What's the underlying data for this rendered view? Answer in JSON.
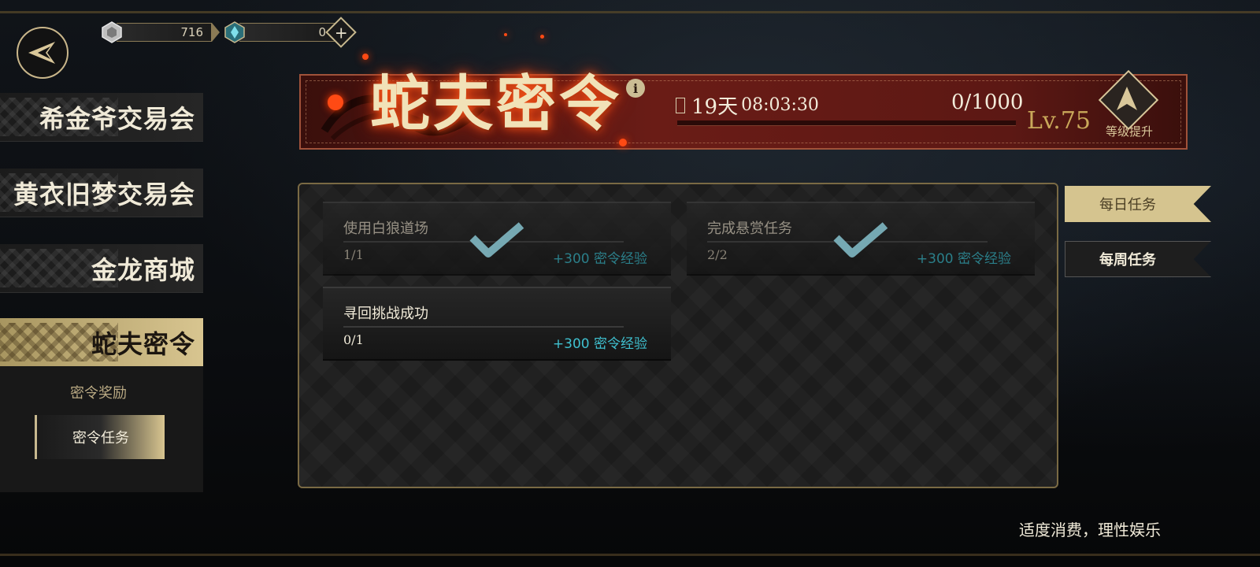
{
  "currency": {
    "silver": {
      "icon": "silver-coin-icon",
      "value": "716"
    },
    "gem": {
      "icon": "crystal-gem-icon",
      "value": "0"
    },
    "add_icon": "plus-icon"
  },
  "nav": {
    "back_icon": "back-arrow-icon",
    "menu": [
      {
        "label": "希金爷交易会"
      },
      {
        "label": "黄衣旧梦交易会"
      },
      {
        "label": "金龙商城"
      },
      {
        "label": "蛇夫密令"
      }
    ],
    "submenu": [
      {
        "label": "密令奖励"
      },
      {
        "label": "密令任务"
      }
    ]
  },
  "banner": {
    "title": "蛇夫密令",
    "info_icon": "i",
    "timer_days": "19天",
    "timer_clock": "08:03:30",
    "progress_text": "0/1000",
    "progress": {
      "current": 0,
      "max": 1000
    },
    "level": "Lv.75",
    "level_up_label": "等级提升"
  },
  "tasks": [
    {
      "name": "使用白狼道场",
      "count": "1/1",
      "reward": "+300 密令经验",
      "completed": true
    },
    {
      "name": "完成悬赏任务",
      "count": "2/2",
      "reward": "+300 密令经验",
      "completed": true
    },
    {
      "name": "寻回挑战成功",
      "count": "0/1",
      "reward": "+300 密令经验",
      "completed": false
    }
  ],
  "tabs": [
    {
      "label": "每日任务",
      "active": true
    },
    {
      "label": "每周任务",
      "active": false
    }
  ],
  "notice": "适度消费，理性娱乐",
  "colors": {
    "accent_gold": "#d5c48f",
    "banner_red": "#6a1c16",
    "reward_teal": "#3fc0cf",
    "check_blue": "#8fd0dc"
  }
}
